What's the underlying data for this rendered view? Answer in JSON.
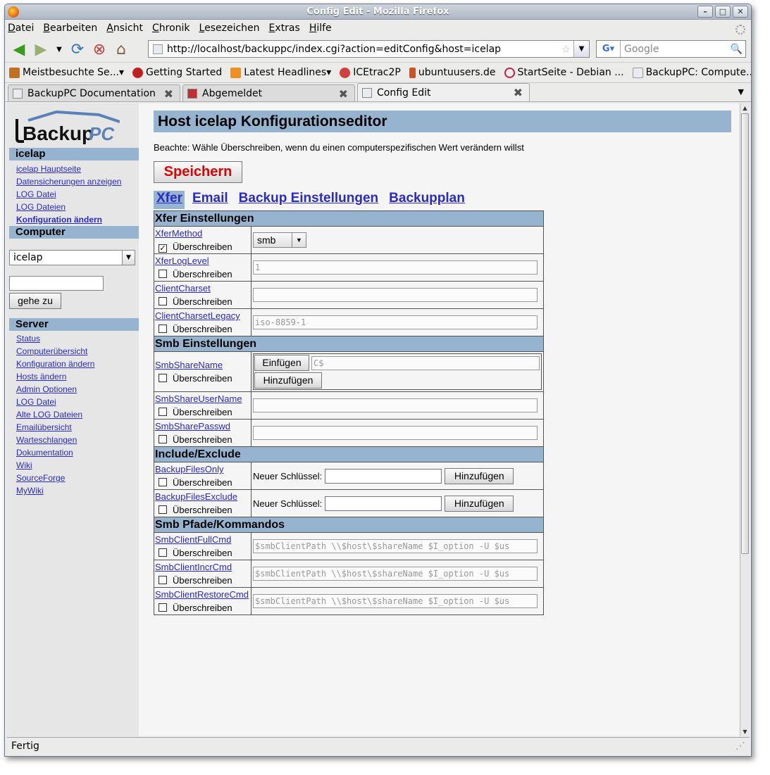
{
  "window": {
    "title": "Config Edit - Mozilla Firefox"
  },
  "menu": [
    "Datei",
    "Bearbeiten",
    "Ansicht",
    "Chronik",
    "Lesezeichen",
    "Extras",
    "Hilfe"
  ],
  "nav": {
    "url": "http://localhost/backuppc/index.cgi?action=editConfig&host=icelap",
    "search_placeholder": "Google",
    "search_engine": "G"
  },
  "bookmarks": [
    "Meistbesuchte Se...",
    "Getting Started",
    "Latest Headlines",
    "ICEtrac2P",
    "ubuntuusers.de",
    "StartSeite - Debian ...",
    "BackupPC: Compute..."
  ],
  "tabs": [
    "BackupPC Documentation",
    "Abgemeldet",
    "Config Edit"
  ],
  "status": "Fertig",
  "sidebar": {
    "logo_a": "Backup",
    "logo_b": "PC",
    "host_header": "icelap",
    "host_links": [
      "icelap Hauptseite",
      "Datensicherungen anzeigen",
      "LOG Datei",
      "LOG Dateien",
      "Konfiguration ändern"
    ],
    "computer_header": "Computer",
    "host_select": "icelap",
    "go_button": "gehe zu",
    "server_header": "Server",
    "server_links": [
      "Status",
      "Computerübersicht",
      "Konfiguration ändern",
      "Hosts ändern",
      "Admin Optionen",
      "LOG Datei",
      "Alte LOG Dateien",
      "Emailübersicht",
      "Warteschlangen",
      "Dokumentation",
      "Wiki",
      "SourceForge",
      "MyWiki"
    ]
  },
  "main": {
    "title": "Host icelap Konfigurationseditor",
    "note": "Beachte: Wähle Überschreiben, wenn du einen computerspezifischen Wert verändern willst",
    "save": "Speichern",
    "subtabs": [
      "Xfer",
      "Email",
      "Backup Einstellungen",
      "Backupplan"
    ],
    "override_label": "Überschreiben",
    "sections": {
      "xfer": "Xfer Einstellungen",
      "smb": "Smb Einstellungen",
      "incl": "Include/Exclude",
      "paths": "Smb Pfade/Kommandos"
    },
    "fields": {
      "XferMethod": {
        "label": "XferMethod",
        "value": "smb"
      },
      "XferLogLevel": {
        "label": "XferLogLevel",
        "value": "1"
      },
      "ClientCharset": {
        "label": "ClientCharset",
        "value": ""
      },
      "ClientCharsetLegacy": {
        "label": "ClientCharsetLegacy",
        "value": "iso-8859-1"
      },
      "SmbShareName": {
        "label": "SmbShareName",
        "value": "C$",
        "insert": "Einfügen",
        "add": "Hinzufügen"
      },
      "SmbShareUserName": {
        "label": "SmbShareUserName",
        "value": ""
      },
      "SmbSharePasswd": {
        "label": "SmbSharePasswd",
        "value": ""
      },
      "BackupFilesOnly": {
        "label": "BackupFilesOnly",
        "new_key": "Neuer Schlüssel:",
        "add": "Hinzufügen"
      },
      "BackupFilesExclude": {
        "label": "BackupFilesExclude",
        "new_key": "Neuer Schlüssel:",
        "add": "Hinzufügen"
      },
      "SmbClientFullCmd": {
        "label": "SmbClientFullCmd",
        "value": "$smbClientPath \\\\$host\\$shareName $I_option -U $us"
      },
      "SmbClientIncrCmd": {
        "label": "SmbClientIncrCmd",
        "value": "$smbClientPath \\\\$host\\$shareName $I_option -U $us"
      },
      "SmbClientRestoreCmd": {
        "label": "SmbClientRestoreCmd",
        "value": "$smbClientPath \\\\$host\\$shareName $I_option -U $us"
      }
    }
  }
}
